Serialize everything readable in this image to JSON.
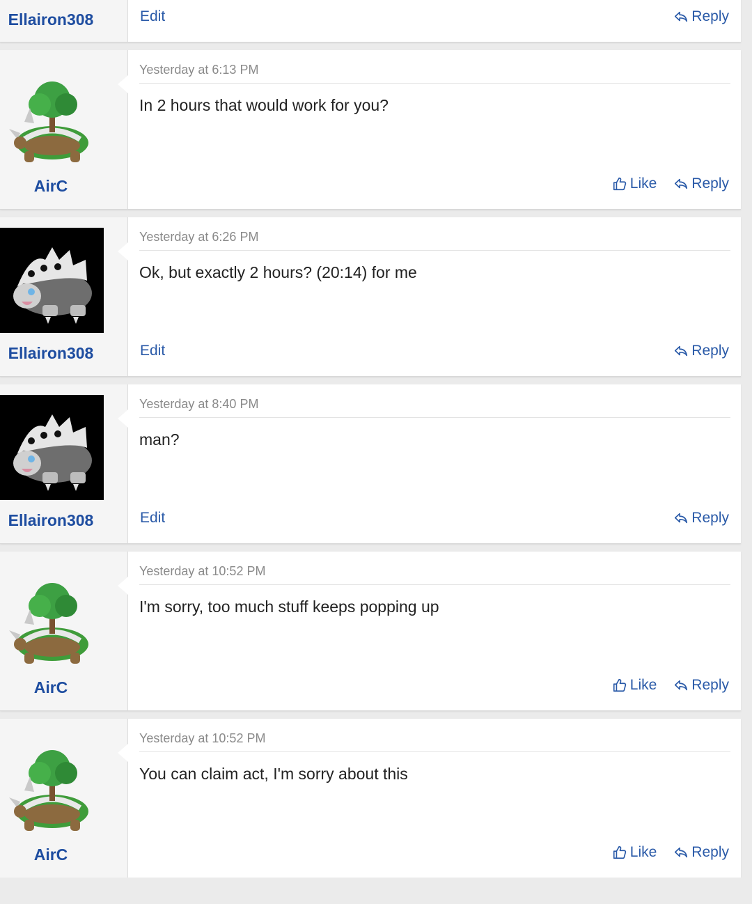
{
  "posts": [
    {
      "username": "Ellairon308",
      "edit_label": "Edit",
      "reply_label": "Reply"
    },
    {
      "username": "AirC",
      "avatar_icon": "torterra-avatar-icon",
      "timestamp": "Yesterday at 6:13 PM",
      "message": "In 2 hours that would work for you?",
      "like_label": "Like",
      "reply_label": "Reply"
    },
    {
      "username": "Ellairon308",
      "avatar_icon": "lairon-avatar-icon",
      "timestamp": "Yesterday at 6:26 PM",
      "message": "Ok, but exactly 2 hours? (20:14) for me",
      "edit_label": "Edit",
      "reply_label": "Reply"
    },
    {
      "username": "Ellairon308",
      "avatar_icon": "lairon-avatar-icon",
      "timestamp": "Yesterday at 8:40 PM",
      "message": "man?",
      "edit_label": "Edit",
      "reply_label": "Reply"
    },
    {
      "username": "AirC",
      "avatar_icon": "torterra-avatar-icon",
      "timestamp": "Yesterday at 10:52 PM",
      "message": "I'm sorry, too much stuff keeps popping up",
      "like_label": "Like",
      "reply_label": "Reply"
    },
    {
      "username": "AirC",
      "avatar_icon": "torterra-avatar-icon",
      "timestamp": "Yesterday at 10:52 PM",
      "message": "You can claim act, I'm sorry about this",
      "like_label": "Like",
      "reply_label": "Reply"
    }
  ],
  "colors": {
    "link": "#2a5aa8",
    "username": "#1e4da0",
    "meta": "#8a8a8a",
    "page_bg": "#ebebeb"
  }
}
